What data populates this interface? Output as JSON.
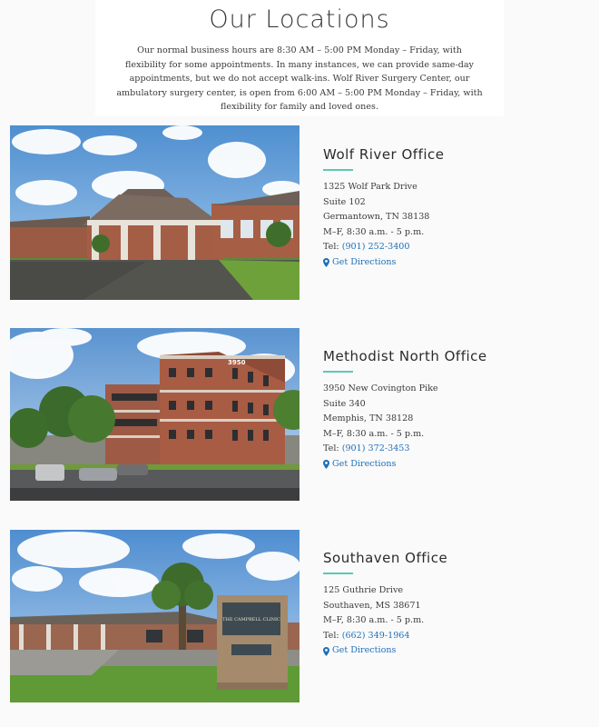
{
  "page": {
    "title": "Our Locations",
    "intro": "Our normal business hours are 8:30 AM – 5:00 PM Monday – Friday, with flexibility for some appointments. In many instances, we can provide same-day appointments, but we do not accept walk-ins. Wolf River Surgery Center, our ambulatory surgery center, is open from 6:00 AM – 5:00 PM Monday – Friday, with flexibility for family and loved ones."
  },
  "colors": {
    "accent_rule": "#5cc9b0",
    "link": "#1e6fb8",
    "text": "#3a3a3a"
  },
  "locations": [
    {
      "name": "Wolf River Office",
      "address1": "1325 Wolf Park Drive",
      "address2": "Suite 102",
      "city": "Germantown, TN 38138",
      "hours": "M–F, 8:30 a.m. - 5 p.m.",
      "tel_label": "Tel:",
      "phone": "(901) 252-3400",
      "directions": "Get Directions",
      "photo_icon": "building-photo"
    },
    {
      "name": "Methodist North Office",
      "address1": "3950 New Covington Pike",
      "address2": "Suite 340",
      "city": "Memphis, TN 38128",
      "hours": "M–F, 8:30 a.m. - 5 p.m.",
      "tel_label": "Tel:",
      "phone": "(901) 372-3453",
      "directions": "Get Directions",
      "photo_icon": "building-photo",
      "building_number": "3950"
    },
    {
      "name": "Southaven Office",
      "address1": "125 Guthrie Drive",
      "city": "Southaven, MS 38671",
      "hours": "M–F, 8:30 a.m. - 5 p.m.",
      "tel_label": "Tel:",
      "phone": "(662) 349-1964",
      "directions": "Get Directions",
      "photo_icon": "building-photo",
      "sign_text": "THE CAMPBELL CLINIC"
    }
  ]
}
